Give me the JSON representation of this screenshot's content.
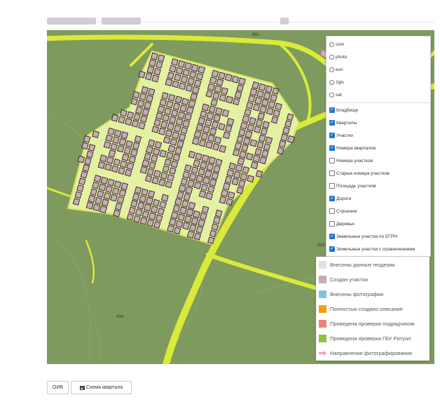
{
  "map": {
    "road_labels": [
      "43A",
      "43A",
      "43A"
    ],
    "layers_panel": {
      "basemaps": [
        {
          "label": "osm",
          "selected": false
        },
        {
          "label": "photo",
          "selected": false
        },
        {
          "label": "esri",
          "selected": false
        },
        {
          "label": "2gis",
          "selected": false
        },
        {
          "label": "sat",
          "selected": false
        }
      ],
      "overlays": [
        {
          "label": "Кладбище",
          "checked": true
        },
        {
          "label": "Кварталы",
          "checked": true
        },
        {
          "label": "Участки",
          "checked": true
        },
        {
          "label": "Номера кварталов",
          "checked": true
        },
        {
          "label": "Номера участков",
          "checked": false
        },
        {
          "label": "Старые номера участков",
          "checked": false
        },
        {
          "label": "Площадь участков",
          "checked": false
        },
        {
          "label": "Дороги",
          "checked": true
        },
        {
          "label": "Строения",
          "checked": false
        },
        {
          "label": "Деревья",
          "checked": false
        },
        {
          "label": "Земельные участки по ЕГРН",
          "checked": true
        },
        {
          "label": "Земельные участки с ограничениями",
          "checked": true
        }
      ]
    },
    "legend": [
      {
        "label": "Внесены данные геодезии",
        "color": "#e6e0e1"
      },
      {
        "label": "Создан участок",
        "color": "#c5aeb3"
      },
      {
        "label": "Внесены фотографии",
        "color": "#7fc8d6"
      },
      {
        "label": "Полностью создано описание",
        "color": "#f3a20f"
      },
      {
        "label": "Проведена проверка подрядчиком",
        "color": "#ee8074"
      },
      {
        "label": "Проведена проверка ГБУ Ритуал",
        "color": "#8dc43e"
      },
      {
        "label": "Направление фотографирования",
        "color": "#f39ac9",
        "icon": "arrow-icon"
      }
    ],
    "colors": {
      "field": "#7e9a5e",
      "road": "#d9ea3a",
      "cemetery_ground": "#e4f0a2",
      "plot_fill": "#c5aeb3",
      "plot_border": "#2b1e22"
    }
  },
  "toolbar": {
    "buttons": [
      {
        "label": "ОИВ"
      },
      {
        "label": "Схема квартала",
        "icon": "picture-icon"
      }
    ]
  }
}
